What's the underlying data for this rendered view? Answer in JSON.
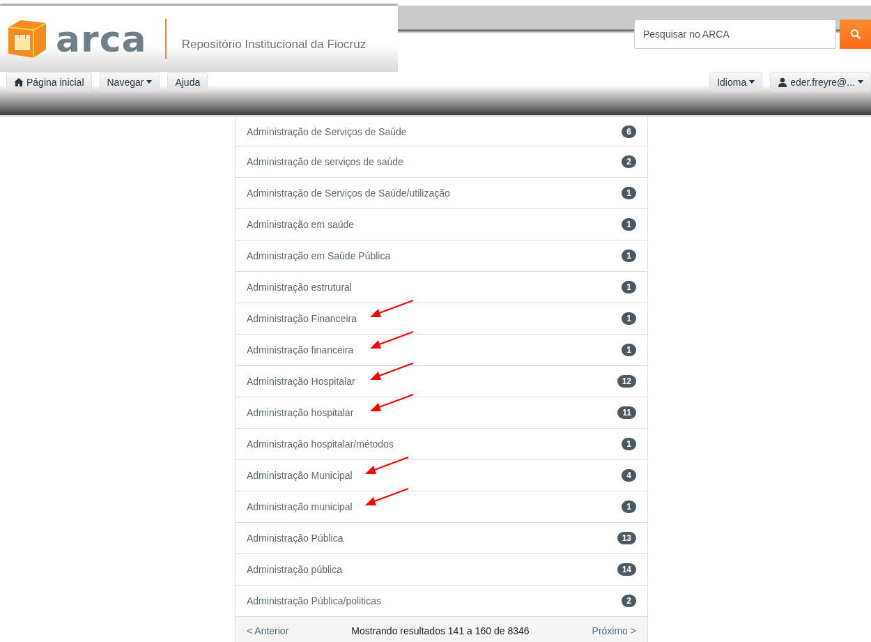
{
  "header": {
    "logo_text": "arca",
    "subtitle": "Repositório Institucional da Fiocruz",
    "search": {
      "placeholder": "Pesquisar no ARCA"
    }
  },
  "nav": {
    "left": [
      {
        "label": "Página inicial",
        "kind": "home"
      },
      {
        "label": "Navegar",
        "kind": "dropdown"
      },
      {
        "label": "Ajuda",
        "kind": "plain"
      }
    ],
    "right": [
      {
        "label": "Idioma",
        "kind": "dropdown"
      },
      {
        "label": "eder.freyre@...",
        "kind": "user"
      }
    ]
  },
  "items": [
    {
      "label": "Administração de Serviços de Saúde",
      "count": "6",
      "arrow": false
    },
    {
      "label": "Administração de serviços de saúde",
      "count": "2",
      "arrow": false
    },
    {
      "label": "Administração de Serviços de Saúde/utilização",
      "count": "1",
      "arrow": false
    },
    {
      "label": "Administração em saúde",
      "count": "1",
      "arrow": false
    },
    {
      "label": "Administração em Saúde Pública",
      "count": "1",
      "arrow": false
    },
    {
      "label": "Administração estrutural",
      "count": "1",
      "arrow": false
    },
    {
      "label": "Administração Financeira",
      "count": "1",
      "arrow": true
    },
    {
      "label": "Administração financeira",
      "count": "1",
      "arrow": true
    },
    {
      "label": "Administração Hospitalar",
      "count": "12",
      "arrow": true
    },
    {
      "label": "Administração hospitalar",
      "count": "11",
      "arrow": true
    },
    {
      "label": "Administração hospitalar/métodos",
      "count": "1",
      "arrow": false
    },
    {
      "label": "Administração Municipal",
      "count": "4",
      "arrow": true
    },
    {
      "label": "Administração municipal",
      "count": "1",
      "arrow": true
    },
    {
      "label": "Administração Pública",
      "count": "13",
      "arrow": false
    },
    {
      "label": "Administração pública",
      "count": "14",
      "arrow": false
    },
    {
      "label": "Administração Pública/politicas",
      "count": "2",
      "arrow": false
    }
  ],
  "pager": {
    "previous": "< Anterior",
    "summary": "Mostrando resultados 141 a 160 de 8346",
    "next": "Próximo >"
  }
}
